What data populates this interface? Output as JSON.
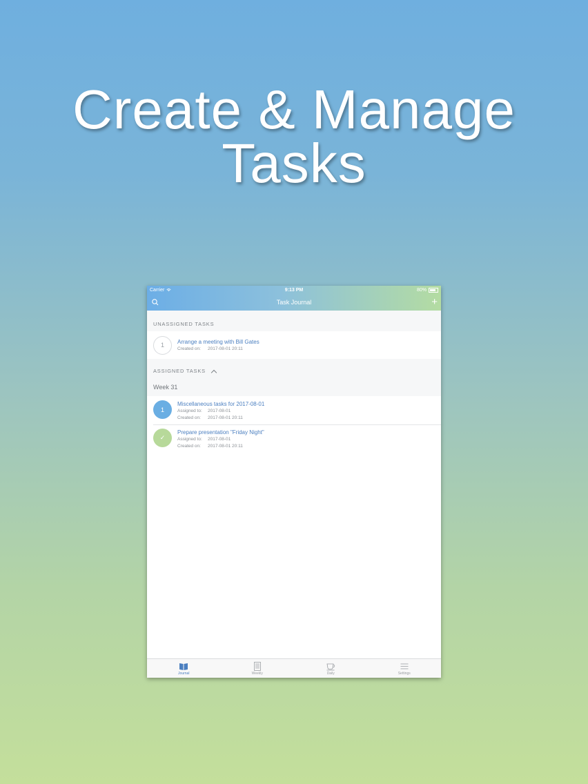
{
  "headline": {
    "line1": "Create & Manage",
    "line2": "Tasks"
  },
  "status_bar": {
    "carrier": "Carrier",
    "time": "9:13 PM",
    "battery": "80%"
  },
  "nav": {
    "title": "Task Journal",
    "search_icon": "search-icon",
    "add_icon": "plus-icon"
  },
  "unassigned": {
    "header": "UNASSIGNED TASKS",
    "items": [
      {
        "badge": "1",
        "title": "Arrange a meeting with Bill Gates",
        "created_label": "Created on:",
        "created_value": "2017-08-01 20:11"
      }
    ]
  },
  "assigned": {
    "header": "ASSIGNED TASKS",
    "week": "Week 31",
    "items": [
      {
        "badge": "1",
        "title": "Miscellaneous tasks for 2017-08-01",
        "assigned_label": "Assigned to:",
        "assigned_value": "2017-08-01",
        "created_label": "Created on:",
        "created_value": "2017-08-01 20:11"
      },
      {
        "badge": "✓",
        "title": "Prepare presentation \"Friday Night\"",
        "assigned_label": "Assigned to:",
        "assigned_value": "2017-08-01",
        "created_label": "Created on:",
        "created_value": "2017-08-01 20:11"
      }
    ]
  },
  "tabs": [
    {
      "label": "Journal",
      "icon": "book-icon",
      "active": true
    },
    {
      "label": "Weekly",
      "icon": "newspaper-icon",
      "active": false
    },
    {
      "label": "Daily",
      "icon": "cup-icon",
      "active": false
    },
    {
      "label": "Settings",
      "icon": "menu-icon",
      "active": false
    }
  ],
  "colors": {
    "accent": "#4b7fc0",
    "blue_badge": "#6aaee3",
    "green_badge": "#b7d99a"
  }
}
